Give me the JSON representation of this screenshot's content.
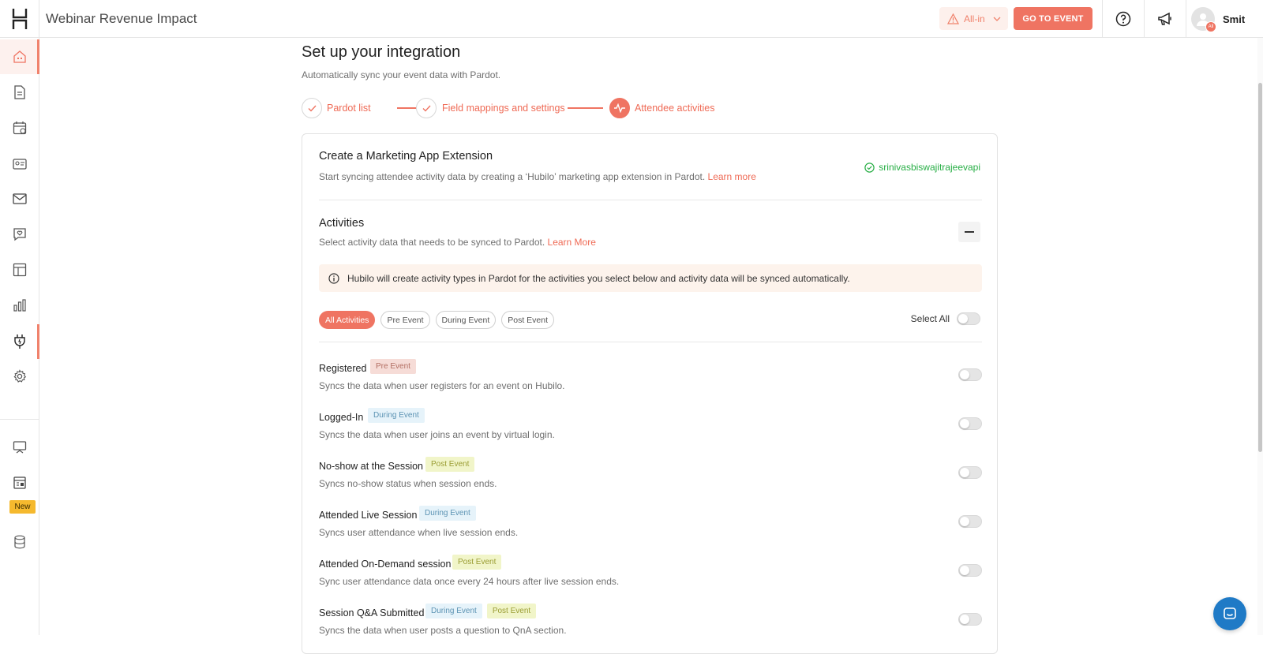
{
  "header": {
    "app_title": "Webinar Revenue Impact",
    "event_filter_label": "All-in",
    "go_to_event_label": "GO TO EVENT",
    "user_name": "Smit",
    "avatar_badge": "All"
  },
  "sidebar": {
    "new_badge": "New",
    "items": [
      {
        "icon": "home-icon",
        "active": true
      },
      {
        "icon": "document-icon"
      },
      {
        "icon": "calendar-icon"
      },
      {
        "icon": "id-card-icon"
      },
      {
        "icon": "mail-icon"
      },
      {
        "icon": "chat-heart-icon"
      },
      {
        "icon": "layout-icon"
      },
      {
        "icon": "bar-chart-icon"
      },
      {
        "icon": "integration-plug-icon",
        "active": true
      },
      {
        "icon": "gear-icon"
      },
      {
        "icon": "presentation-icon"
      },
      {
        "icon": "calendar-grid-icon"
      },
      {
        "icon": "database-icon"
      }
    ]
  },
  "page": {
    "title": "Set up your integration",
    "subtitle": "Automatically sync your event data with Pardot."
  },
  "stepper": {
    "steps": [
      {
        "label": "Pardot list",
        "state": "done"
      },
      {
        "label": "Field mappings and settings",
        "state": "done"
      },
      {
        "label": "Attendee activities",
        "state": "current"
      }
    ]
  },
  "extension": {
    "title": "Create a Marketing App Extension",
    "description": "Start syncing attendee activity data by creating a ‘Hubilo’ marketing app extension in Pardot.",
    "learn_more": "Learn more",
    "account": "srinivasbiswajitrajeevapi"
  },
  "activities": {
    "title": "Activities",
    "description": "Select activity data that needs to be synced to Pardot.",
    "learn_more": "Learn More",
    "info": "Hubilo will create activity types in Pardot for the activities you select below and activity data will be synced automatically.",
    "filters": [
      "All Activities",
      "Pre Event",
      "During Event",
      "Post Event"
    ],
    "select_all_label": "Select All",
    "items": [
      {
        "name": "Registered",
        "tags": [
          {
            "label": "Pre Event",
            "kind": "pre"
          }
        ],
        "description": "Syncs the data when user registers for an event on Hubilo.",
        "enabled": false
      },
      {
        "name": "Logged-In",
        "tags": [
          {
            "label": "During Event",
            "kind": "during"
          }
        ],
        "description": "Syncs the data when user joins an event by virtual login.",
        "enabled": false
      },
      {
        "name": "No-show at the Session",
        "tags": [
          {
            "label": "Post Event",
            "kind": "post"
          }
        ],
        "description": "Syncs no-show status when session ends.",
        "enabled": false
      },
      {
        "name": "Attended Live Session",
        "tags": [
          {
            "label": "During Event",
            "kind": "during"
          }
        ],
        "description": "Syncs user attendance when live session ends.",
        "enabled": false
      },
      {
        "name": "Attended On-Demand session",
        "tags": [
          {
            "label": "Post Event",
            "kind": "post"
          }
        ],
        "description": "Sync user attendance data once every 24 hours after live session ends.",
        "enabled": false
      },
      {
        "name": "Session Q&A Submitted",
        "tags": [
          {
            "label": "During Event",
            "kind": "during"
          },
          {
            "label": "Post Event",
            "kind": "post"
          }
        ],
        "description": "Syncs the data when user posts a question to QnA section.",
        "enabled": false
      }
    ]
  },
  "colors": {
    "accent": "#ef7462",
    "success": "#27ae45",
    "new_badge": "#f5b92e",
    "chat_button": "#1f7ac6"
  }
}
